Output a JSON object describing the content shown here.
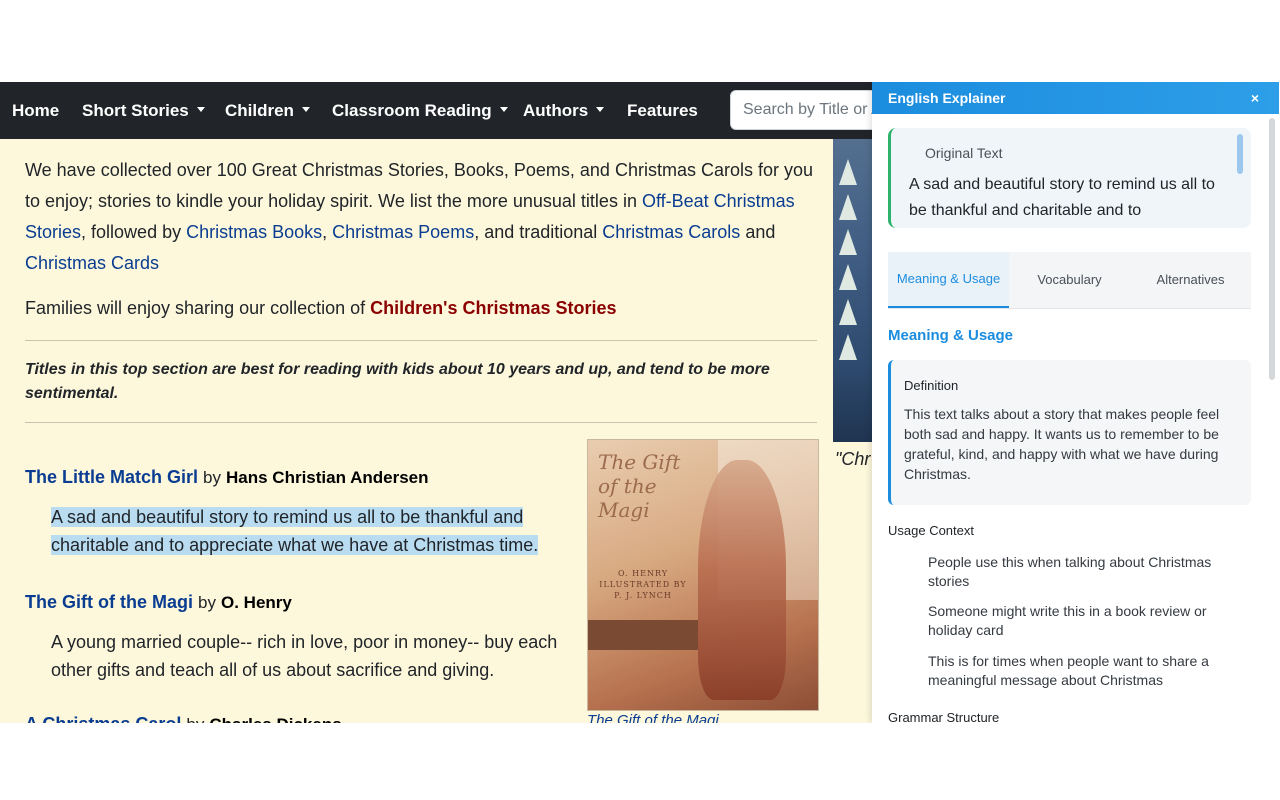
{
  "nav": {
    "items": [
      {
        "label": "Home",
        "dropdown": false
      },
      {
        "label": "Short Stories",
        "dropdown": true
      },
      {
        "label": "Children",
        "dropdown": true
      },
      {
        "label": "Classroom Reading",
        "dropdown": true
      },
      {
        "label": "Authors",
        "dropdown": true
      },
      {
        "label": "Features",
        "dropdown": false
      }
    ],
    "search_placeholder": "Search by Title or Author"
  },
  "content": {
    "intro": {
      "part1": "We have collected over 100 Great Christmas Stories, Books, Poems, and Christmas Carols for you to enjoy; stories to kindle your holiday spirit. We list the more unusual titles in ",
      "link1": "Off-Beat Christmas Stories",
      "part2": ", followed by ",
      "link2": "Christmas Books",
      "part3": ", ",
      "link3": "Christmas Poems",
      "part4": ", and traditional ",
      "link4": "Christmas Carols",
      "part5": " and ",
      "link5": "Christmas Cards"
    },
    "families_text": "Families will enjoy sharing our collection of ",
    "families_link": "Children's Christmas Stories",
    "note": "Titles in this top section are best for reading with kids about 10 years and up, and tend to be more sentimental.",
    "stories": [
      {
        "title": "The Little Match Girl",
        "by": "by",
        "author": "Hans Christian Andersen",
        "description": "A sad and beautiful story to remind us all to be thankful and charitable and to appreciate what we have at Christmas time."
      },
      {
        "title": "The Gift of the Magi",
        "by": "by",
        "author": "O. Henry",
        "description": "A young married couple-- rich in love, poor in money-- buy each other gifts and teach all of us about sacrifice and giving."
      },
      {
        "title": "A Christmas Carol",
        "by": "by",
        "author": "Charles Dickens"
      }
    ],
    "cover": {
      "title": "The Gift of the Magi",
      "author": "O. HENRY",
      "illustrated": "ILLUSTRATED BY",
      "illustrator": "P. J. LYNCH",
      "caption": "The Gift of the Magi"
    },
    "tree_caption": "\"Chr"
  },
  "panel": {
    "title": "English Explainer",
    "close": "×",
    "original_label": "Original Text",
    "original_text": "A sad and beautiful story to remind us all to be thankful and charitable and to",
    "tabs": [
      "Meaning & Usage",
      "Vocabulary",
      "Alternatives"
    ],
    "active_tab": 0,
    "section_title": "Meaning & Usage",
    "definition_label": "Definition",
    "definition_text": "This text talks about a story that makes people feel both sad and happy. It wants us to remember to be grateful, kind, and happy with what we have during Christmas.",
    "usage_label": "Usage Context",
    "usage_items": [
      "People use this when talking about Christmas stories",
      "Someone might write this in a book review or holiday card",
      "This is for times when people want to share a meaningful message about Christmas"
    ],
    "grammar_label": "Grammar Structure"
  },
  "colors": {
    "nav_bg": "#212529",
    "page_bg": "#fdf8dc",
    "link": "#0a3d91",
    "accent_red": "#8b0000",
    "panel_accent": "#1c8dde",
    "highlight": "#b9dcf1"
  }
}
